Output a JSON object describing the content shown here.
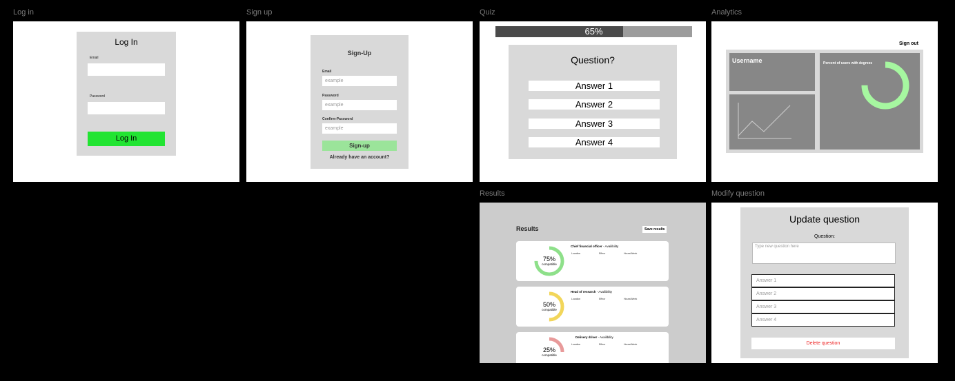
{
  "frames": {
    "login": {
      "label": "Log in",
      "title": "Log In",
      "email_label": "Email",
      "password_label": "Password",
      "button": "Log In"
    },
    "signup": {
      "label": "Sign up",
      "title": "Sign-Up",
      "email_label": "Email",
      "email_placeholder": "example",
      "password_label": "Password",
      "password_placeholder": "example",
      "confirm_label": "Confirm-Password",
      "confirm_placeholder": "example",
      "button": "Sign-up",
      "link": "Already have an account?"
    },
    "quiz": {
      "label": "Quiz",
      "progress_text": "65%",
      "progress_value": 0.65,
      "question": "Question?",
      "answers": [
        "Answer 1",
        "Answer 2",
        "Answer 3",
        "Answer 4"
      ]
    },
    "analytics": {
      "label": "Analytics",
      "signout": "Sign out",
      "username": "Username",
      "percent_label": "Percent of users with degrees",
      "donut_value": 0.75
    },
    "results": {
      "label": "Results",
      "title": "Results",
      "save": "Save results",
      "jobs": [
        {
          "title": "Chief financial officer",
          "sep": " - ",
          "availability": "Availibility",
          "location": "Location",
          "effnor": "Effnor",
          "hours": "Hours/Week",
          "pct": "75%",
          "compat": "compatible",
          "value": 0.75,
          "color": "#8ee08a"
        },
        {
          "title": "Head of research",
          "sep": " - ",
          "availability": "Availibility",
          "location": "Location",
          "effnor": "Effnor",
          "hours": "Hours/Week",
          "pct": "50%",
          "compat": "compatible",
          "value": 0.5,
          "color": "#f2d65a"
        },
        {
          "title": "Delivery driver",
          "sep": " - ",
          "availability": "Availibility",
          "location": "Location",
          "effnor": "Effnor",
          "hours": "Hours/Week",
          "pct": "25%",
          "compat": "compatible",
          "value": 0.25,
          "color": "#e89a9a"
        }
      ]
    },
    "modify": {
      "label": "Modify question",
      "title": "Update question",
      "question_label": "Question:",
      "question_placeholder": "Type new question here",
      "answers": [
        "Answer 1",
        "Answer 2",
        "Answer 3",
        "Answer 4"
      ],
      "delete": "Delete question"
    }
  }
}
